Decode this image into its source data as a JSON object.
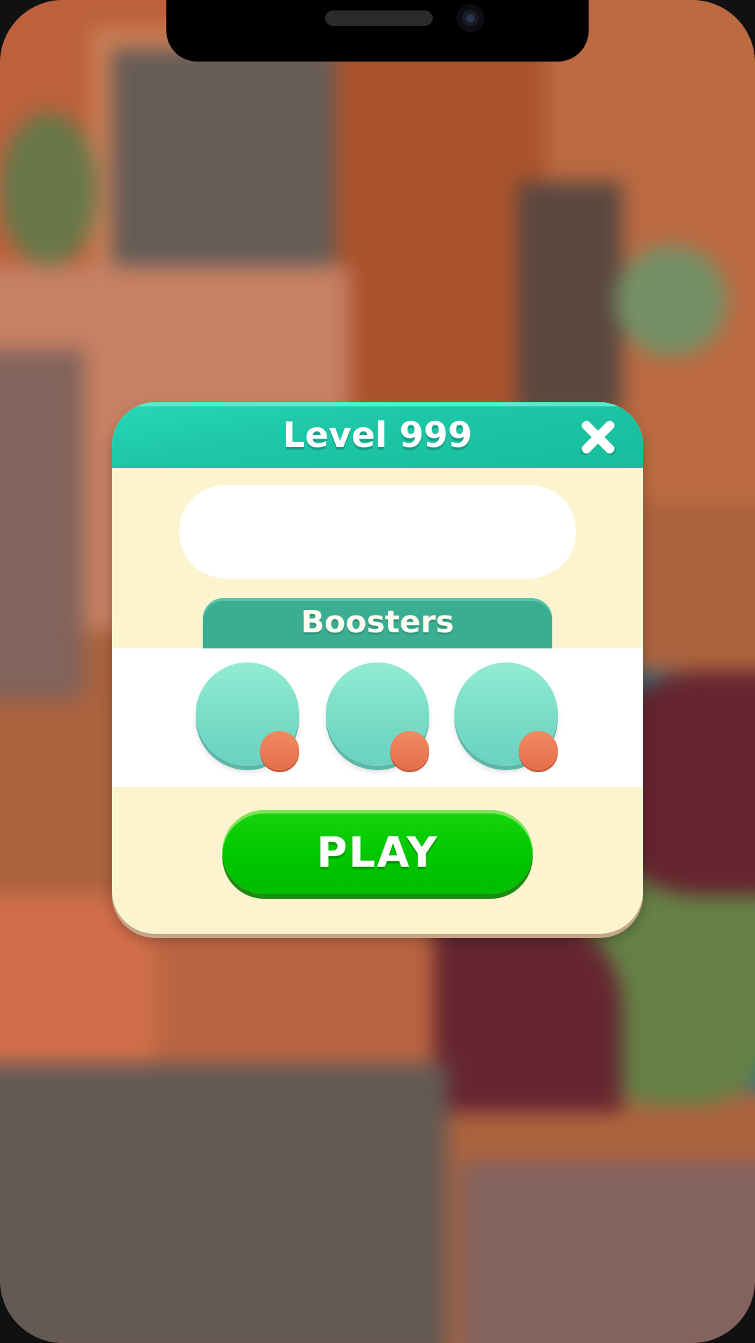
{
  "dialog": {
    "title": "Level 999",
    "close_icon": "close-x-icon",
    "boosters_label": "Boosters",
    "boosters": [
      {
        "icon": "booster-slot-empty"
      },
      {
        "icon": "booster-slot-empty"
      },
      {
        "icon": "booster-slot-empty"
      }
    ],
    "play_label": "PLAY"
  },
  "colors": {
    "header": "#1ec7a7",
    "panel": "#fbf4cf",
    "boosters_tab": "#3bae92",
    "booster_circle": "#78dcc6",
    "booster_badge": "#e66e4b",
    "play_button": "#00c800"
  }
}
